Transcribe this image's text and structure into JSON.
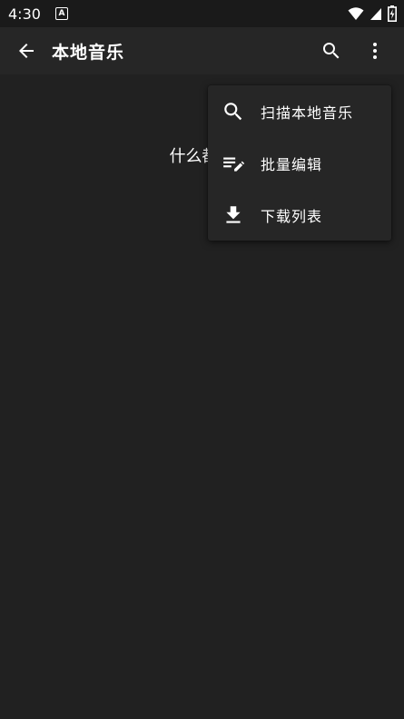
{
  "status_bar": {
    "time": "4:30",
    "notification_icon": "A"
  },
  "app_bar": {
    "title": "本地音乐"
  },
  "content": {
    "empty_text": "什么都没"
  },
  "overflow_menu": {
    "items": [
      {
        "label": "扫描本地音乐",
        "icon": "search-icon"
      },
      {
        "label": "批量编辑",
        "icon": "edit-list-icon"
      },
      {
        "label": "下载列表",
        "icon": "download-icon"
      }
    ]
  }
}
